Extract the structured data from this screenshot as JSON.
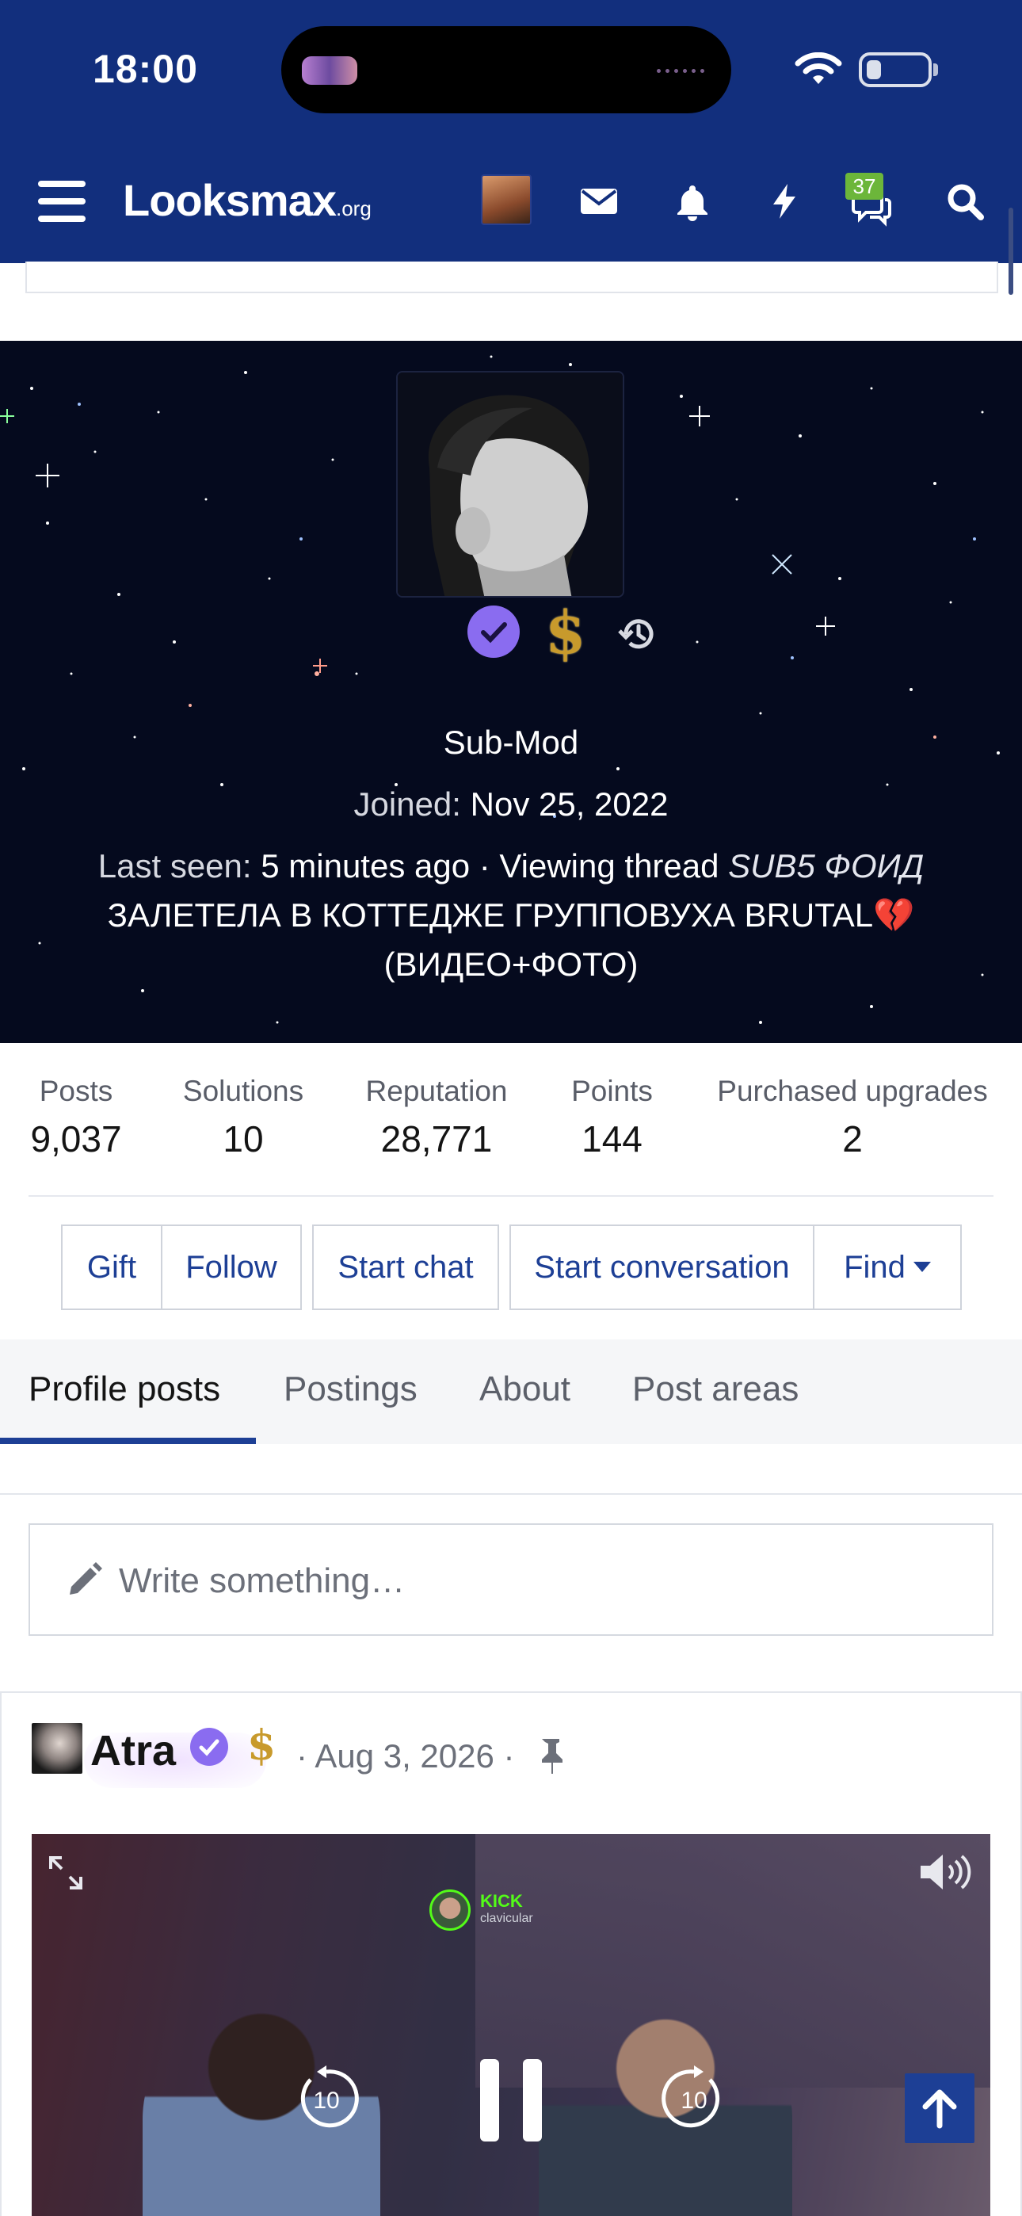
{
  "status_bar": {
    "time": "18:00"
  },
  "nav": {
    "logo_main": "Looksmax",
    "logo_suffix": ".org",
    "conversations_badge": "37",
    "icons": [
      "menu-icon",
      "avatar",
      "envelope-icon",
      "bell-icon",
      "bolt-icon",
      "chat-icon",
      "search-icon"
    ]
  },
  "profile": {
    "title": "Sub-Mod",
    "joined_label": "Joined:",
    "joined_date": "Nov 25, 2022",
    "last_seen_label": "Last seen:",
    "last_seen_value": "5 minutes ago · Viewing thread",
    "thread_line1": "SUB5 ФОИД",
    "thread_line2": "ЗАЛЕТЕЛА В КОТТЕДЖЕ ГРУППОВУХА BRUTAL💔",
    "thread_line3": "(ВИДЕО+ФОТО)"
  },
  "stats": [
    {
      "label": "Posts",
      "value": "9,037"
    },
    {
      "label": "Solutions",
      "value": "10"
    },
    {
      "label": "Reputation",
      "value": "28,771"
    },
    {
      "label": "Points",
      "value": "144"
    },
    {
      "label": "Purchased upgrades",
      "value": "2"
    }
  ],
  "actions": {
    "gift": "Gift",
    "follow": "Follow",
    "start_chat": "Start chat",
    "start_conversation": "Start conversation",
    "find": "Find"
  },
  "tabs": [
    {
      "label": "Profile posts",
      "active": true
    },
    {
      "label": "Postings",
      "active": false
    },
    {
      "label": "About",
      "active": false
    },
    {
      "label": "Post areas",
      "active": false
    }
  ],
  "composer": {
    "placeholder": "Write something…"
  },
  "post": {
    "author": "Atra",
    "meta": "· Aug 3, 2026 ·",
    "video": {
      "overlay_brand": "KICK",
      "overlay_user": "clavicular",
      "rewind_seconds": "10",
      "forward_seconds": "10"
    }
  },
  "colors": {
    "header_bg": "#122f7d",
    "accent": "#1d3f95",
    "verified": "#8a6cf0",
    "dollar": "#c89a2c",
    "badge_green": "#6cb63a"
  }
}
